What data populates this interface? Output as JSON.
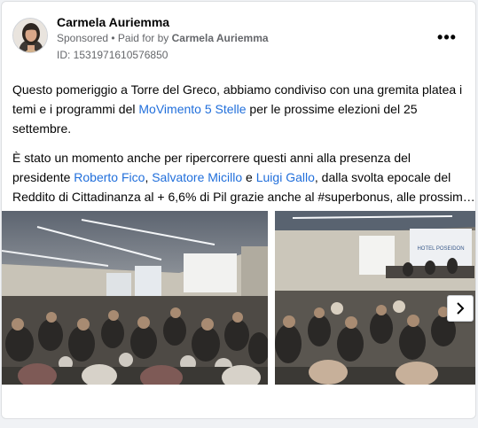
{
  "post": {
    "author": "Carmela Auriemma",
    "sponsored_label": "Sponsored",
    "separator": " • ",
    "paid_prefix": "Paid for by ",
    "paid_by": "Carmela Auriemma",
    "ad_id": "ID: 1531971610576850",
    "more_icon": "more-horizontal-icon",
    "more_glyph": "•••"
  },
  "body": {
    "p1_a": "Questo pomeriggio a Torre del Greco, abbiamo condiviso con una gremita platea i temi e i programmi del ",
    "p1_link": "MoVimento 5 Stelle",
    "p1_b": " per le prossime elezioni del 25 settembre.",
    "p2_line1": "È stato un momento anche per ripercorrere questi anni alla presenza del",
    "p2_a": "presidente ",
    "p2_link1": "Roberto Fico",
    "p2_sep1": ", ",
    "p2_link2": "Salvatore Micillo",
    "p2_sep2": " e ",
    "p2_link3": "Luigi Gallo",
    "p2_b": ", dalla svolta epocale del",
    "p2_line3": "Reddito di Cittadinanza al + 6,6% di Pil grazie anche al #superbonus, alle prossim…"
  },
  "carousel": {
    "photo_sign": "HOTEL POSEIDON",
    "next_icon": "chevron-right-icon"
  },
  "colors": {
    "link": "#216fdb",
    "secondary_text": "#65676b",
    "primary_text": "#050505"
  }
}
